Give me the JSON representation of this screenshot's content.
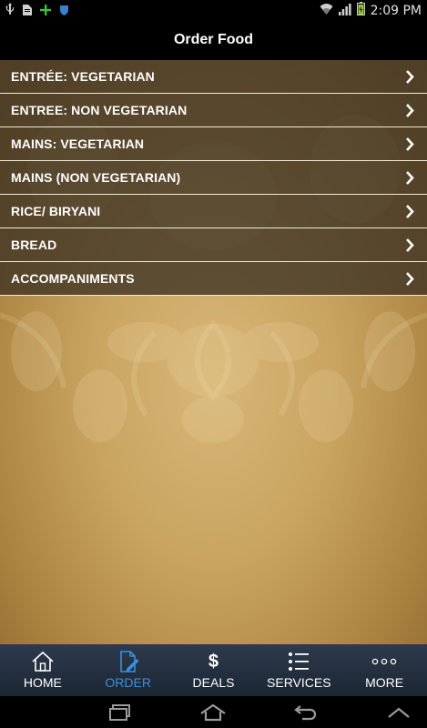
{
  "status_bar": {
    "time": "2:09 PM",
    "left_icons": [
      "usb-icon",
      "sd-card-icon",
      "plus-icon",
      "shield-icon"
    ],
    "right_icons": [
      "wifi-icon",
      "signal-icon",
      "battery-icon"
    ]
  },
  "header": {
    "title": "Order Food"
  },
  "menu": {
    "items": [
      {
        "label": "ENTRÉE: VEGETARIAN"
      },
      {
        "label": "ENTREE: NON VEGETARIAN"
      },
      {
        "label": "MAINS: VEGETARIAN"
      },
      {
        "label": "MAINS (NON VEGETARIAN)"
      },
      {
        "label": "RICE/ BIRYANI"
      },
      {
        "label": "BREAD"
      },
      {
        "label": "ACCOMPANIMENTS"
      }
    ]
  },
  "tabs": {
    "items": [
      {
        "label": "HOME",
        "icon": "home-icon"
      },
      {
        "label": "ORDER",
        "icon": "order-pencil-icon",
        "active": true
      },
      {
        "label": "DEALS",
        "icon": "dollar-icon",
        "glyph": "$"
      },
      {
        "label": "SERVICES",
        "icon": "list-icon"
      },
      {
        "label": "MORE",
        "icon": "more-dots-icon"
      }
    ],
    "active_color": "#3a8fe0"
  },
  "system_nav": {
    "buttons": [
      "recent-apps-icon",
      "home-nav-icon",
      "back-icon",
      "menu-up-icon"
    ]
  }
}
